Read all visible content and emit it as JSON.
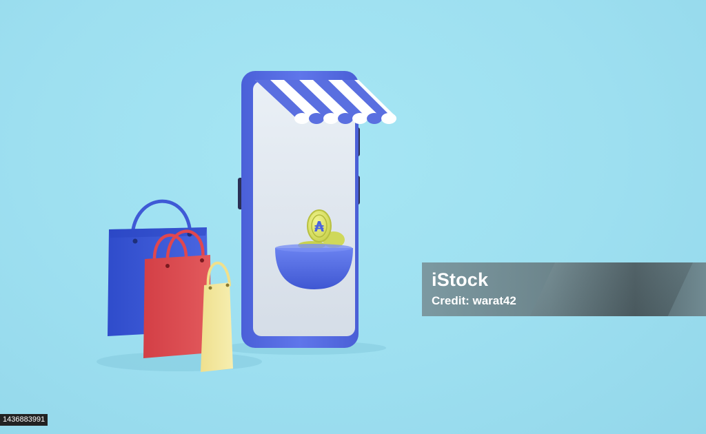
{
  "watermark": {
    "logo_text": "iStock",
    "credit_text": "Credit: warat42"
  },
  "image_id": "1436883991",
  "coin_symbol": "₳",
  "colors": {
    "background": "#9ddff0",
    "phone_body": "#5b6fe0",
    "phone_screen": "#dfe6ee",
    "awning_stripe": "#5a6fe0",
    "bag_blue": "#3b59d8",
    "bag_red": "#d8454b",
    "bag_yellow": "#f2e69a",
    "coin": "#dfe56f"
  }
}
